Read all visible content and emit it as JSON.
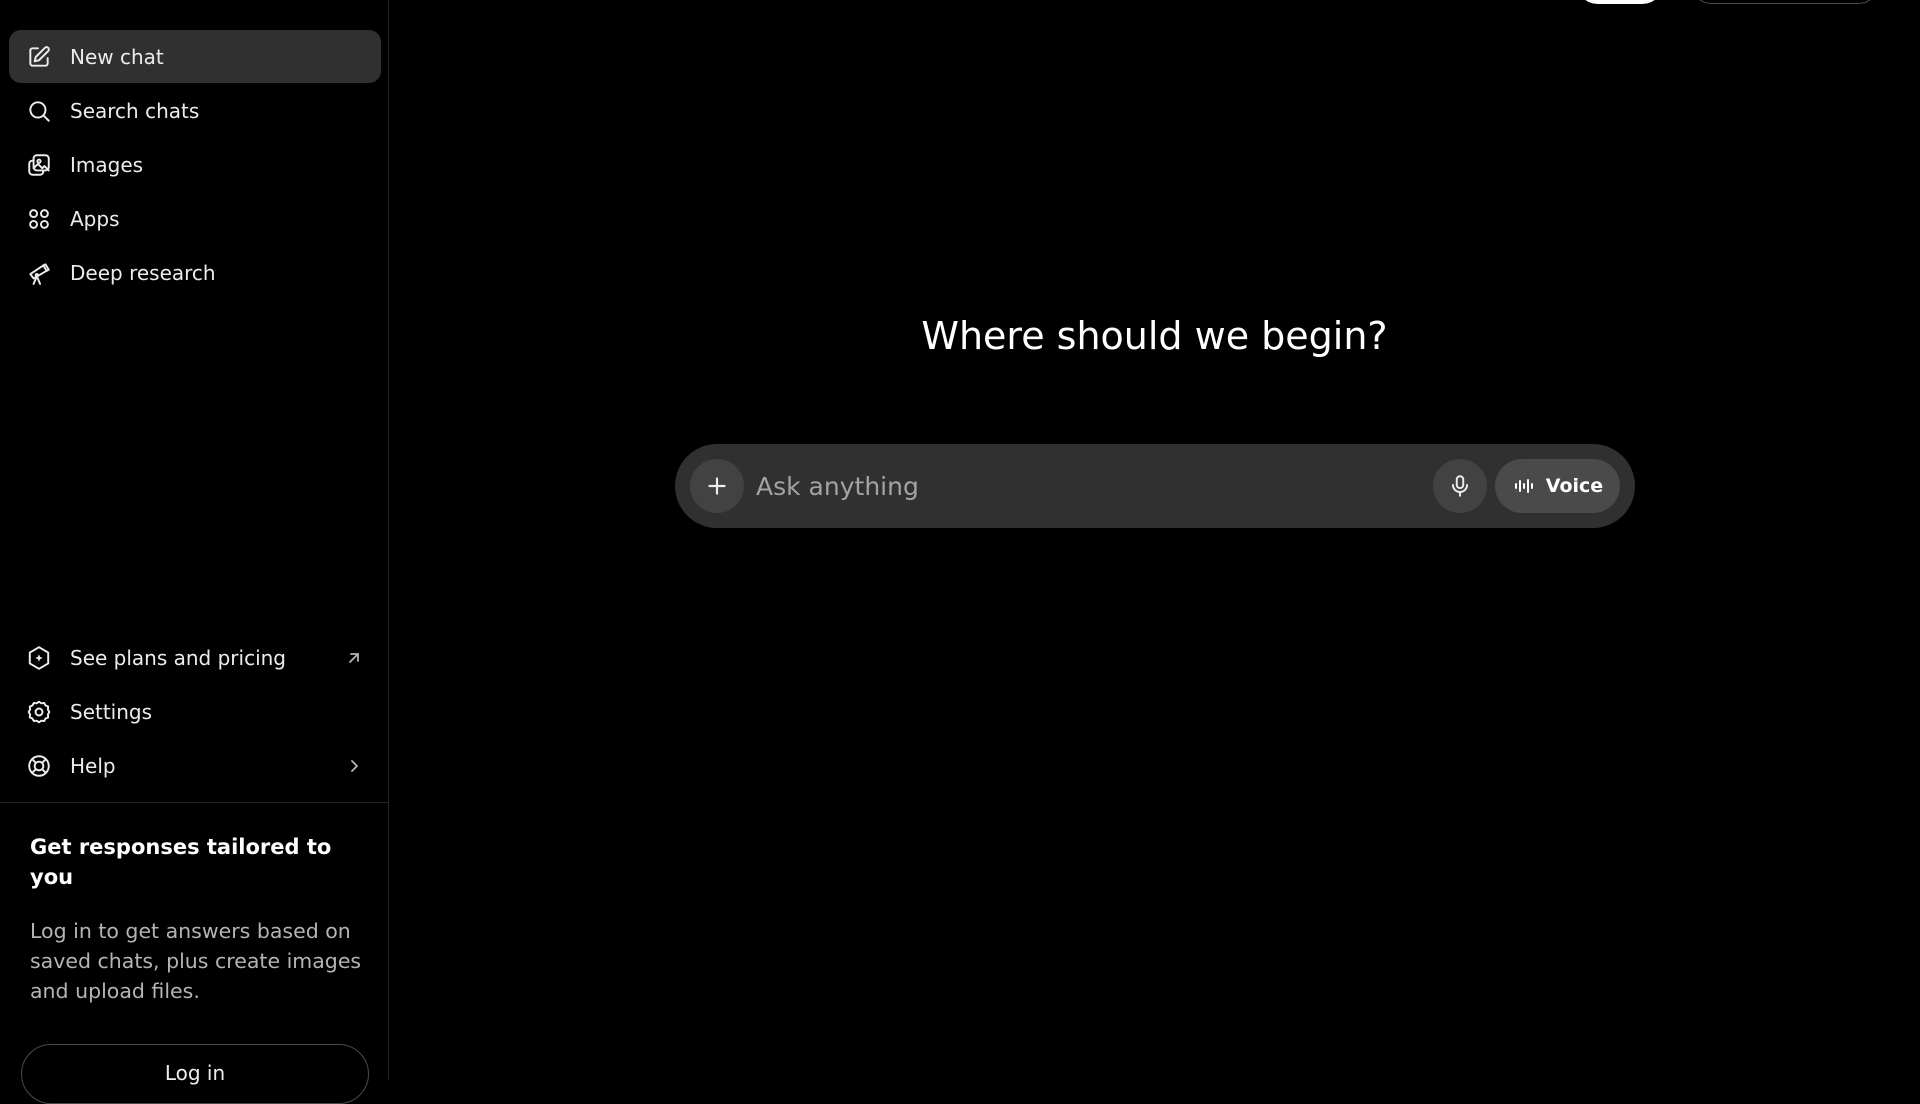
{
  "sidebar": {
    "items": [
      {
        "label": "New chat",
        "icon": "new-chat-icon"
      },
      {
        "label": "Search chats",
        "icon": "search-icon"
      },
      {
        "label": "Images",
        "icon": "images-icon"
      },
      {
        "label": "Apps",
        "icon": "apps-icon"
      },
      {
        "label": "Deep research",
        "icon": "telescope-icon"
      }
    ],
    "bottom_items": [
      {
        "label": "See plans and pricing",
        "icon": "plans-icon",
        "trailing_icon": "external-arrow-icon"
      },
      {
        "label": "Settings",
        "icon": "gear-icon"
      },
      {
        "label": "Help",
        "icon": "help-icon",
        "trailing_icon": "chevron-right-icon"
      }
    ],
    "promo": {
      "title": "Get responses tailored to you",
      "body": "Log in to get answers based on saved chats, plus create images and upload files.",
      "login_label": "Log in"
    }
  },
  "main": {
    "headline": "Where should we begin?",
    "composer": {
      "placeholder": "Ask anything",
      "plus_icon": "plus-icon",
      "mic_icon": "microphone-icon",
      "voice_label": "Voice",
      "voice_icon": "waveform-icon"
    }
  },
  "colors": {
    "background": "#000000",
    "active_item": "#303030",
    "composer": "#303030"
  }
}
